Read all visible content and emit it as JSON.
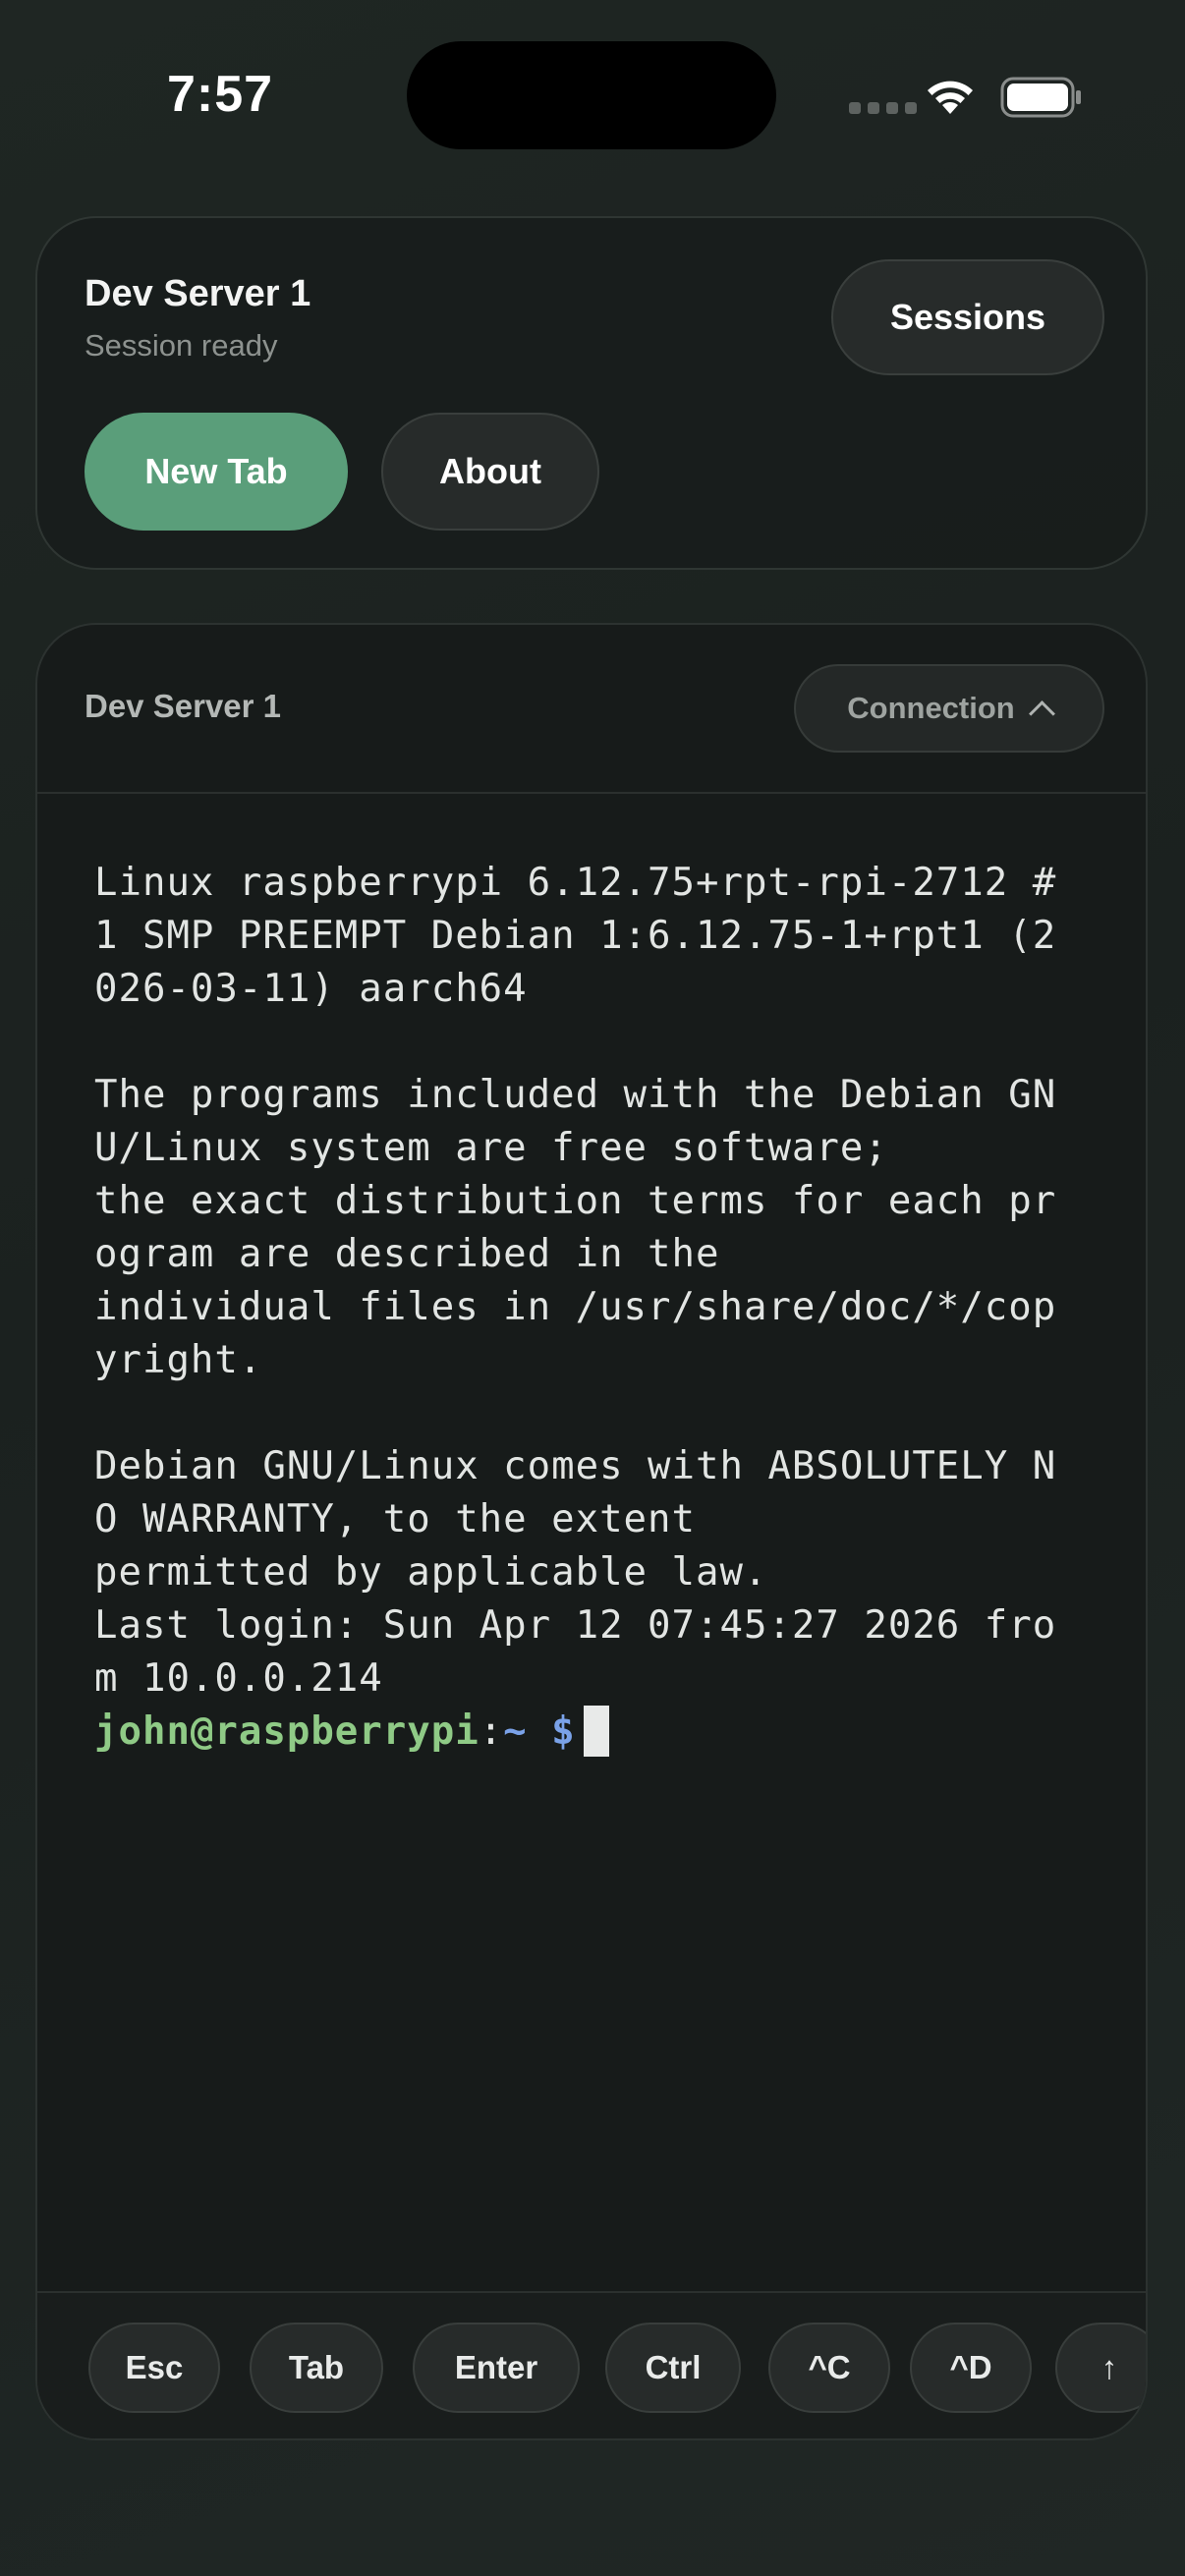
{
  "status_bar": {
    "time": "7:57"
  },
  "header": {
    "server_name": "Dev Server 1",
    "session_status": "Session ready",
    "sessions_label": "Sessions",
    "new_tab_label": "New Tab",
    "about_label": "About"
  },
  "terminal_panel": {
    "title": "Dev Server 1",
    "connection_label": "Connection"
  },
  "terminal": {
    "lines": [
      "Linux raspberrypi 6.12.75+rpt-rpi-2712 #",
      "1 SMP PREEMPT Debian 1:6.12.75-1+rpt1 (2",
      "026-03-11) aarch64",
      "",
      "The programs included with the Debian GN",
      "U/Linux system are free software;",
      "the exact distribution terms for each pr",
      "ogram are described in the",
      "individual files in /usr/share/doc/*/cop",
      "yright.",
      "",
      "Debian GNU/Linux comes with ABSOLUTELY N",
      "O WARRANTY, to the extent",
      "permitted by applicable law.",
      "Last login: Sun Apr 12 07:45:27 2026 fro",
      "m 10.0.0.214"
    ],
    "prompt_user": "john@raspberrypi",
    "prompt_sep": ":",
    "prompt_path": "~ $"
  },
  "keys": [
    "Esc",
    "Tab",
    "Enter",
    "Ctrl",
    "^C",
    "^D",
    "↑"
  ],
  "colors": {
    "accent": "#5a9e7a",
    "prompt_user": "#8fca86",
    "prompt_path": "#7aa2e8"
  }
}
